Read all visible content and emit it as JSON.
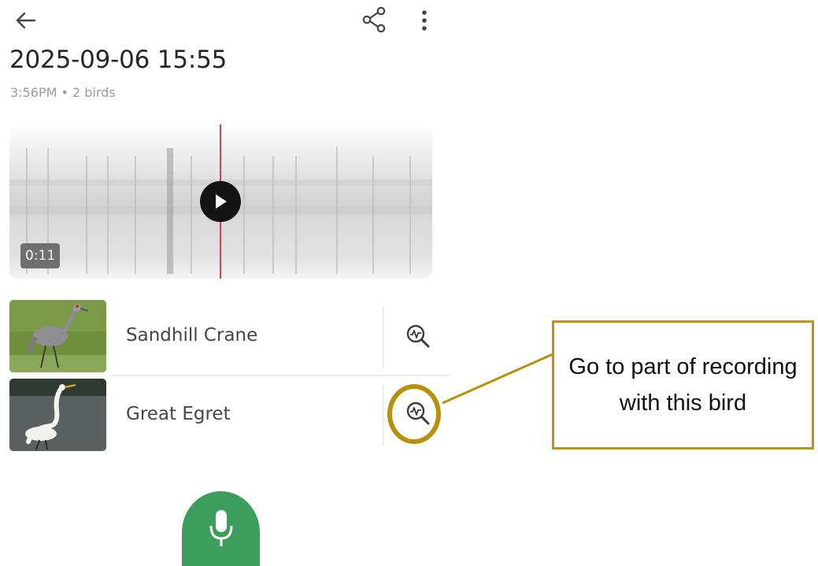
{
  "recording": {
    "title": "2025-09-06 15:55",
    "time": "3:56PM",
    "separator": "•",
    "bird_count": "2 birds",
    "duration": "0:11"
  },
  "birds": [
    {
      "name": "Sandhill Crane"
    },
    {
      "name": "Great Egret"
    }
  ],
  "callout": {
    "text": "Go to part of recording with this bird"
  },
  "icons": {
    "back": "arrow-left-icon",
    "share": "share-icon",
    "more": "more-vertical-icon",
    "play": "play-icon",
    "find_in_recording": "magnify-waveform-icon",
    "record": "microphone-icon"
  },
  "colors": {
    "accent_green": "#3c9e5c",
    "playhead": "#d9414c",
    "callout_gold": "#bf9410"
  }
}
